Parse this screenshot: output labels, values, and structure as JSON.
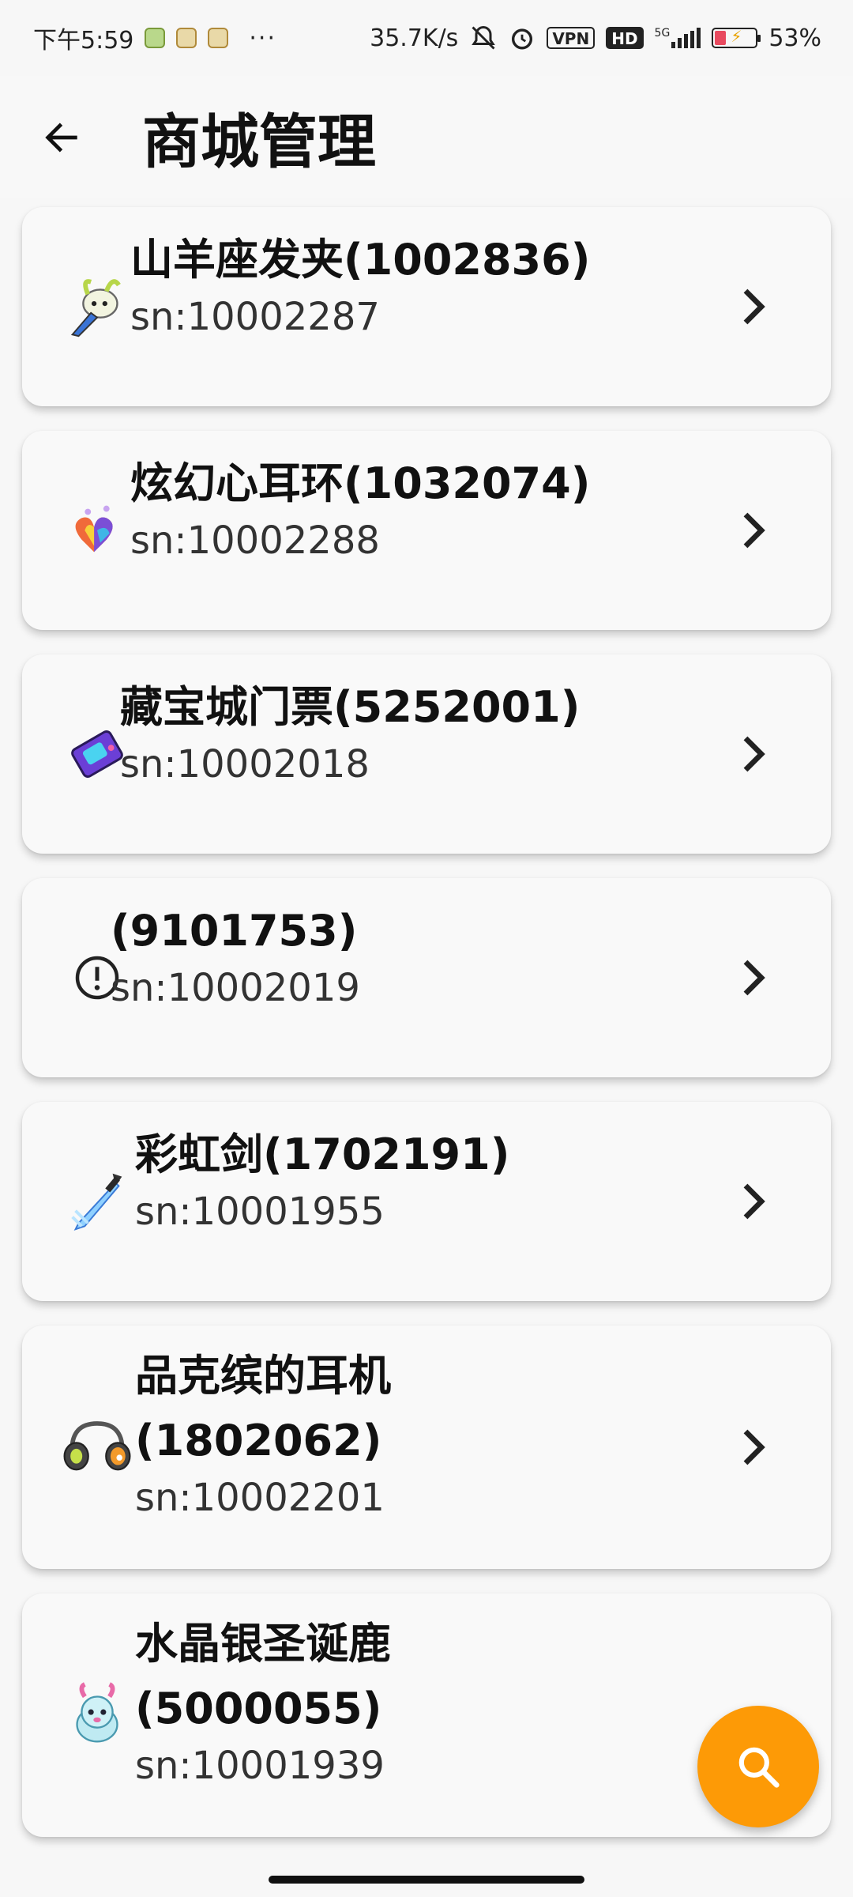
{
  "status_bar": {
    "time": "下午5:59",
    "dots": "···",
    "network_speed": "35.7K/s",
    "vpn": "VPN",
    "hd": "HD",
    "network_type": "5G",
    "battery": "53%"
  },
  "header": {
    "title": "商城管理"
  },
  "items": [
    {
      "name": "山羊座发夹(1002836)",
      "sn": "sn:10002287",
      "icon": "goat-hairpin-icon"
    },
    {
      "name": "炫幻心耳环(1032074)",
      "sn": "sn:10002288",
      "icon": "rainbow-heart-earring-icon"
    },
    {
      "name": "藏宝城门票(5252001)",
      "sn": "sn:10002018",
      "icon": "ticket-icon"
    },
    {
      "name": "(9101753)",
      "sn": "sn:10002019",
      "icon": "alert-circle-icon"
    },
    {
      "name": "彩虹剑(1702191)",
      "sn": "sn:10001955",
      "icon": "rainbow-sword-icon"
    },
    {
      "name_line1": "品克缤的耳机",
      "name_line2": "(1802062)",
      "sn": "sn:10002201",
      "icon": "headphones-icon"
    },
    {
      "name_line1": "水晶银圣诞鹿",
      "name_line2": "(5000055)",
      "sn": "sn:10001939",
      "icon": "crystal-deer-icon"
    }
  ],
  "fab": {
    "icon": "search-icon"
  },
  "colors": {
    "accent": "#fd9a06",
    "background": "#f7f7f7",
    "card": "#f9f9f9"
  }
}
